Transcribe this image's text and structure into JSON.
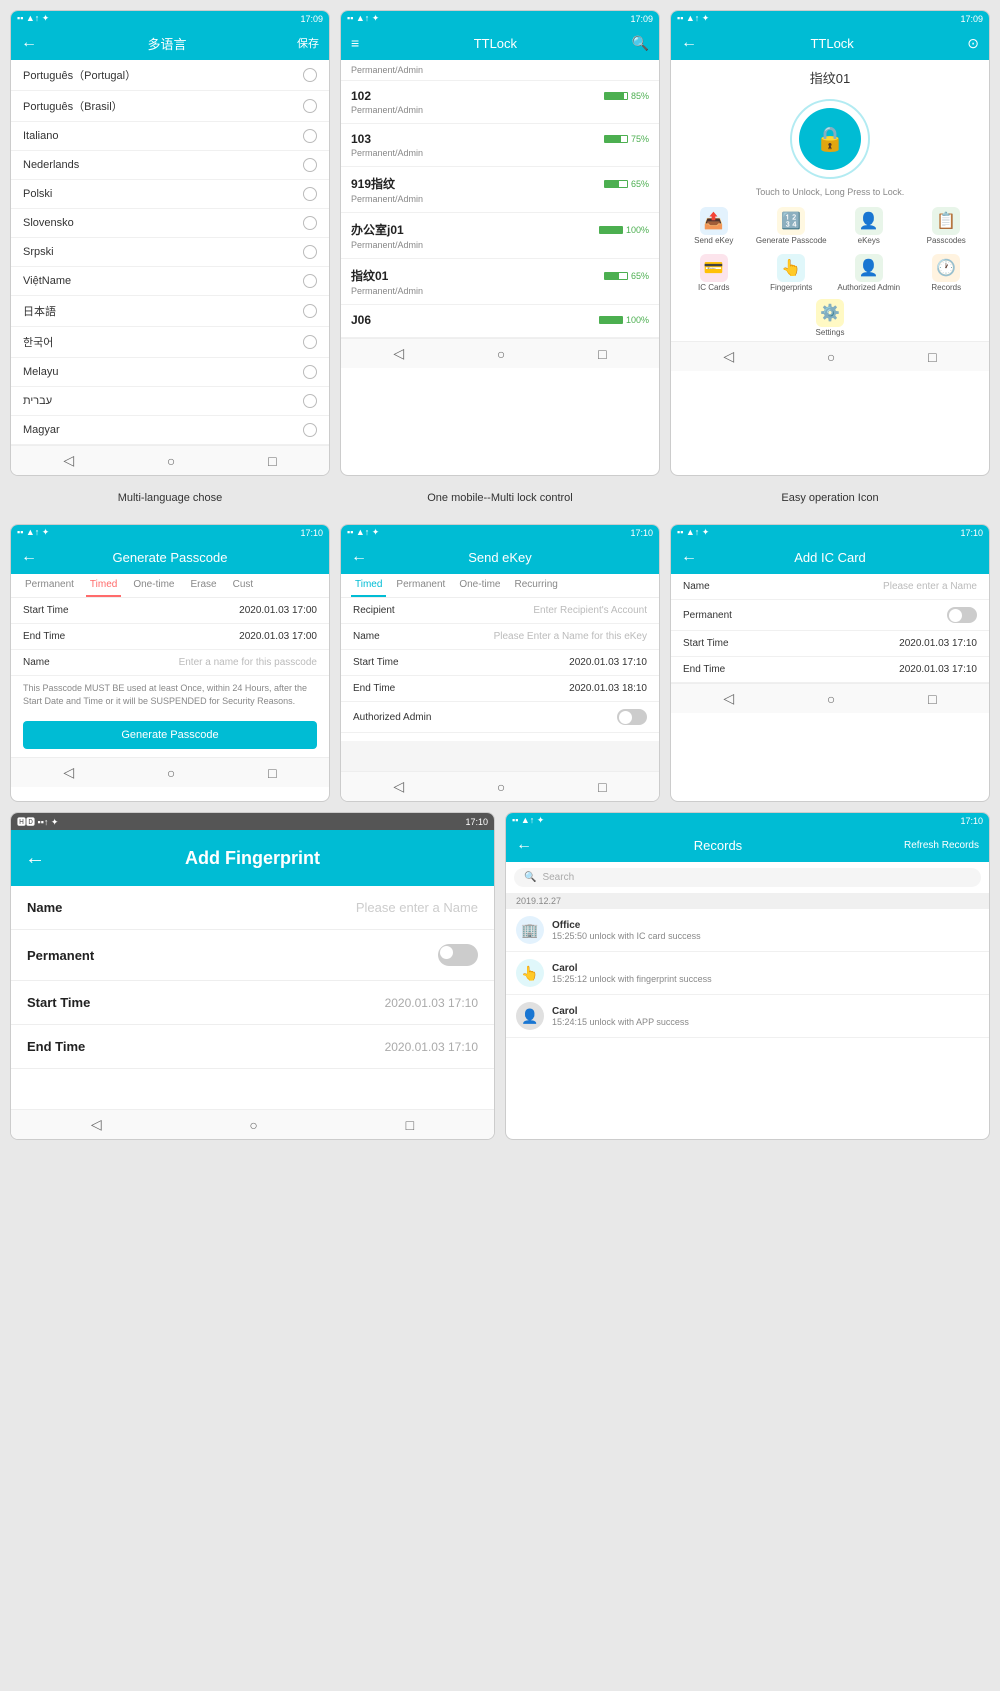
{
  "screens": {
    "language": {
      "statusBar": "17:09",
      "backLabel": "←",
      "title": "多语言",
      "saveLabel": "保存",
      "languages": [
        "Português（Portugal）",
        "Português（Brasil）",
        "Italiano",
        "Nederlands",
        "Polski",
        "Slovensko",
        "Srpski",
        "ViệtName",
        "日本語",
        "한국어",
        "Melayu",
        "עברית",
        "Magyar"
      ]
    },
    "lockList": {
      "statusBar": "17:09",
      "menuLabel": "≡",
      "title": "TTLock",
      "searchLabel": "🔍",
      "topItem": {
        "name": "Permanent/Admin"
      },
      "locks": [
        {
          "name": "102",
          "battery": 85,
          "sub": "Permanent/Admin"
        },
        {
          "name": "103",
          "battery": 75,
          "sub": "Permanent/Admin"
        },
        {
          "name": "919指纹",
          "battery": 65,
          "sub": "Permanent/Admin"
        },
        {
          "name": "办公室j01",
          "battery": 100,
          "sub": "Permanent/Admin"
        },
        {
          "name": "指纹01",
          "battery": 65,
          "sub": "Permanent/Admin"
        },
        {
          "name": "J06",
          "battery": 100,
          "sub": ""
        }
      ]
    },
    "lockMain": {
      "statusBar": "17:09",
      "backLabel": "←",
      "title": "TTLock",
      "settingsLabel": "⊙",
      "lockName": "指纹01",
      "touchHint": "Touch to Unlock, Long Press to Lock.",
      "icons": [
        {
          "label": "Send eKey",
          "emoji": "📤",
          "color": "#e3f2fd"
        },
        {
          "label": "Generate Passcode",
          "emoji": "🔢",
          "color": "#fff8e1"
        },
        {
          "label": "eKeys",
          "emoji": "👤",
          "color": "#e8f5e9"
        },
        {
          "label": "Passcodes",
          "emoji": "📋",
          "color": "#e8f5e9"
        },
        {
          "label": "IC Cards",
          "emoji": "💳",
          "color": "#fce4ec"
        },
        {
          "label": "Fingerprints",
          "emoji": "👆",
          "color": "#e0f7fa"
        },
        {
          "label": "Authorized Admin",
          "emoji": "👤",
          "color": "#e8f5e9"
        },
        {
          "label": "Records",
          "emoji": "🕐",
          "color": "#fff3e0"
        },
        {
          "label": "Settings",
          "emoji": "⚙️",
          "color": "#fff9c4"
        }
      ]
    },
    "generatePasscode": {
      "statusBar": "17:10",
      "backLabel": "←",
      "title": "Generate Passcode",
      "tabs": [
        "Permanent",
        "Timed",
        "One-time",
        "Erase",
        "Cust"
      ],
      "activeTab": "Timed",
      "startTime": "2020.01.03 17:00",
      "endTime": "2020.01.03 17:00",
      "namePlaceholder": "Enter a name for this passcode",
      "infoText": "This Passcode MUST BE used at least Once, within 24 Hours, after the Start Date and Time or it will be SUSPENDED for Security Reasons.",
      "buttonLabel": "Generate Passcode"
    },
    "sendEKey": {
      "statusBar": "17:10",
      "backLabel": "←",
      "title": "Send eKey",
      "tabs": [
        "Timed",
        "Permanent",
        "One-time",
        "Recurring"
      ],
      "activeTab": "Timed",
      "recipientLabel": "Recipient",
      "recipientPlaceholder": "Enter Recipient's Account",
      "nameLabel": "Name",
      "namePlaceholder": "Please Enter a Name for this eKey",
      "startTimeLabel": "Start Time",
      "startTime": "2020.01.03 17:10",
      "endTimeLabel": "End Time",
      "endTime": "2020.01.03 18:10",
      "authorizedAdminLabel": "Authorized Admin",
      "authorizedAdminToggle": false
    },
    "addICCard": {
      "statusBar": "17:10",
      "backLabel": "←",
      "title": "Add IC Card",
      "nameLabel": "Name",
      "namePlaceholder": "Please enter a Name",
      "permanentLabel": "Permanent",
      "permanentToggle": false,
      "startTimeLabel": "Start Time",
      "startTime": "2020.01.03 17:10",
      "endTimeLabel": "End Time",
      "endTime": "2020.01.03 17:10"
    },
    "addFingerprint": {
      "statusBar": "17:10",
      "backLabel": "←",
      "title": "Add Fingerprint",
      "nameLabel": "Name",
      "namePlaceholder": "Please enter a Name",
      "permanentLabel": "Permanent",
      "permanentToggle": false,
      "startTimeLabel": "Start Time",
      "startTime": "2020.01.03 17:10",
      "endTimeLabel": "End Time",
      "endTime": "2020.01.03 17:10"
    },
    "records": {
      "statusBar": "17:10",
      "backLabel": "←",
      "title": "Records",
      "refreshLabel": "Refresh Records",
      "searchPlaceholder": "Search",
      "dateGroup": "2019.12.27",
      "items": [
        {
          "name": "Office",
          "detail": "15:25:50 unlock with IC card success",
          "avatar": "🏢",
          "color": "#e3f2fd"
        },
        {
          "name": "Carol",
          "detail": "15:25:12 unlock with fingerprint success",
          "avatar": "👆",
          "color": "#e0f7fa"
        },
        {
          "name": "Carol",
          "detail": "15:24:15 unlock with APP success",
          "avatar": "👤",
          "color": "#e0e0e0"
        }
      ]
    }
  },
  "labels": {
    "multiLanguage": "Multi-language chose",
    "multiLock": "One mobile--Multi lock control",
    "easyOperation": "Easy operation Icon"
  }
}
